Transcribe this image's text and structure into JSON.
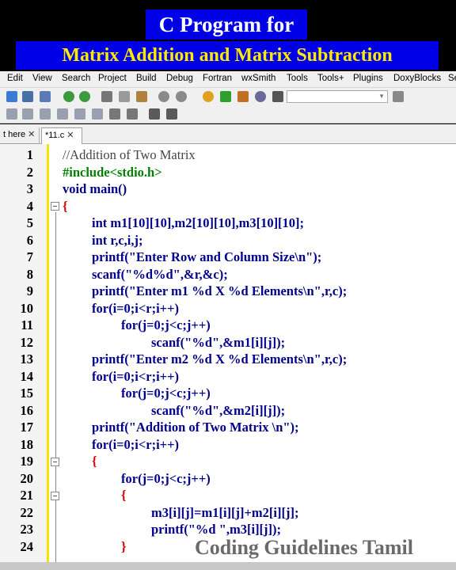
{
  "banner": {
    "line1": "C Program for",
    "line2": "Matrix Addition and Matrix Subtraction"
  },
  "menubar": [
    "Edit",
    "View",
    "Search",
    "Project",
    "Build",
    "Debug",
    "Fortran",
    "wxSmith",
    "Tools",
    "Tools+",
    "Plugins",
    "DoxyBlocks",
    "Se"
  ],
  "tabs": [
    {
      "label": "t here",
      "close": "✕"
    },
    {
      "label": "*11.c",
      "close": "✕"
    }
  ],
  "code_lines": [
    {
      "num": "1",
      "text": "//Addition of Two Matrix"
    },
    {
      "num": "2",
      "text": "#include<stdio.h>"
    },
    {
      "num": "3",
      "text": "void main()"
    },
    {
      "num": "4",
      "text": "{"
    },
    {
      "num": "5",
      "text": "int m1[10][10],m2[10][10],m3[10][10];"
    },
    {
      "num": "6",
      "text": "int r,c,i,j;"
    },
    {
      "num": "7",
      "text": "printf(\"Enter Row and Column Size\\n\");"
    },
    {
      "num": "8",
      "text": "scanf(\"%d%d\",&r,&c);"
    },
    {
      "num": "9",
      "text": "printf(\"Enter m1 %d X %d Elements\\n\",r,c);"
    },
    {
      "num": "10",
      "text": "for(i=0;i<r;i++)"
    },
    {
      "num": "11",
      "text": "for(j=0;j<c;j++)"
    },
    {
      "num": "12",
      "text": "scanf(\"%d\",&m1[i][j]);"
    },
    {
      "num": "13",
      "text": "printf(\"Enter m2 %d X %d Elements\\n\",r,c);"
    },
    {
      "num": "14",
      "text": "for(i=0;i<r;i++)"
    },
    {
      "num": "15",
      "text": "for(j=0;j<c;j++)"
    },
    {
      "num": "16",
      "text": "scanf(\"%d\",&m2[i][j]);"
    },
    {
      "num": "17",
      "text": "printf(\"Addition of Two Matrix \\n\");"
    },
    {
      "num": "18",
      "text": "for(i=0;i<r;i++)"
    },
    {
      "num": "19",
      "text": "{"
    },
    {
      "num": "20",
      "text": "for(j=0;j<c;j++)"
    },
    {
      "num": "21",
      "text": "{"
    },
    {
      "num": "22",
      "text": "m3[i][j]=m1[i][j]+m2[i][j];"
    },
    {
      "num": "23",
      "text": "printf(\"%d \",m3[i][j]);"
    },
    {
      "num": "24",
      "text": "}"
    }
  ],
  "watermark": "Coding Guidelines Tamil",
  "toolbar_icons": [
    "new-file-icon",
    "open-icon",
    "save-icon",
    "save-all-icon",
    "undo-icon",
    "redo-icon",
    "cut-icon",
    "copy-icon",
    "paste-icon",
    "find-icon",
    "replace-icon",
    "settings-icon",
    "run-icon",
    "build-run-icon",
    "rebuild-icon",
    "stop-icon"
  ]
}
